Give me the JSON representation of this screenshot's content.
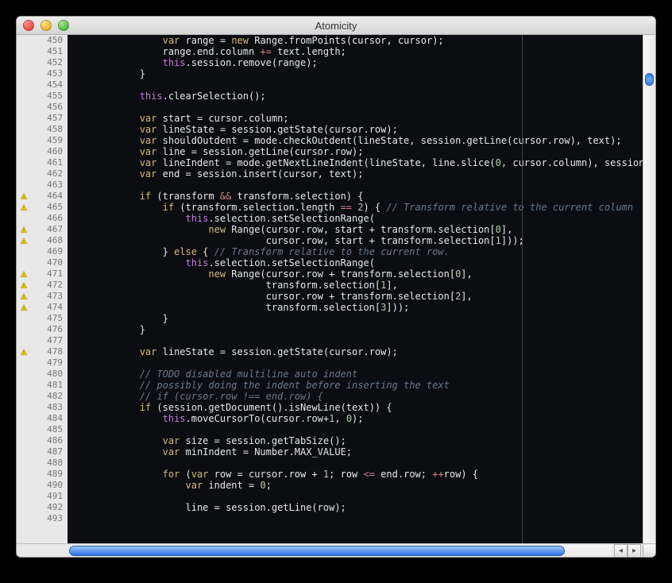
{
  "window": {
    "title": "Atomicity"
  },
  "syntax": {
    "keywords": [
      "var",
      "new",
      "if",
      "else",
      "for",
      "this"
    ],
    "numberRegex": "\\b\\d+\\b"
  },
  "editor": {
    "firstLine": 450,
    "rulerColumn": 80,
    "warnings": [
      464,
      465,
      467,
      468,
      471,
      472,
      473,
      474,
      478
    ],
    "lines": [
      "                var range = new Range.fromPoints(cursor, cursor);",
      "                range.end.column += text.length;",
      "                this.session.remove(range);",
      "            }",
      "",
      "            this.clearSelection();",
      "",
      "            var start = cursor.column;",
      "            var lineState = session.getState(cursor.row);",
      "            var shouldOutdent = mode.checkOutdent(lineState, session.getLine(cursor.row), text);",
      "            var line = session.getLine(cursor.row);",
      "            var lineIndent = mode.getNextLineIndent(lineState, line.slice(0, cursor.column), session.getTabString(",
      "            var end = session.insert(cursor, text);",
      "",
      "            if (transform && transform.selection) {",
      "                if (transform.selection.length == 2) { // Transform relative to the current column",
      "                    this.selection.setSelectionRange(",
      "                        new Range(cursor.row, start + transform.selection[0],",
      "                                  cursor.row, start + transform.selection[1]));",
      "                } else { // Transform relative to the current row.",
      "                    this.selection.setSelectionRange(",
      "                        new Range(cursor.row + transform.selection[0],",
      "                                  transform.selection[1],",
      "                                  cursor.row + transform.selection[2],",
      "                                  transform.selection[3]));",
      "                }",
      "            }",
      "",
      "            var lineState = session.getState(cursor.row);",
      "",
      "            // TODO disabled multiline auto indent",
      "            // possibly doing the indent before inserting the text",
      "            // if (cursor.row !== end.row) {",
      "            if (session.getDocument().isNewLine(text)) {",
      "                this.moveCursorTo(cursor.row+1, 0);",
      "",
      "                var size = session.getTabSize();",
      "                var minIndent = Number.MAX_VALUE;",
      "",
      "                for (var row = cursor.row + 1; row <= end.row; ++row) {",
      "                    var indent = 0;",
      "",
      "                    line = session.getLine(row);",
      ""
    ]
  }
}
